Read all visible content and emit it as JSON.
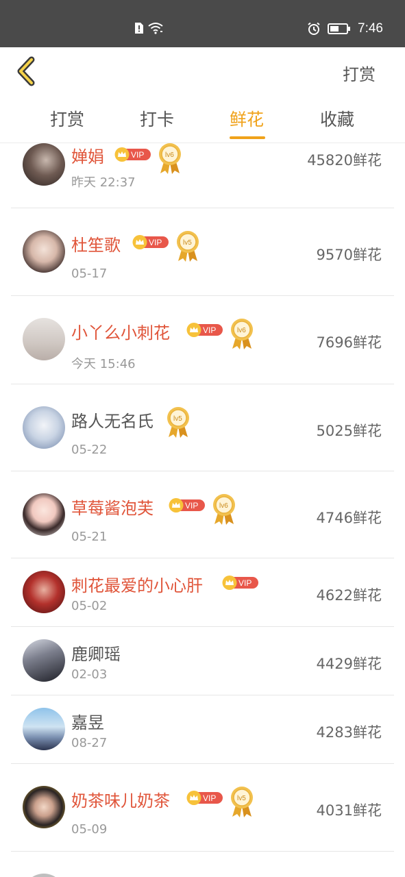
{
  "status_bar": {
    "time": "7:46",
    "icons": [
      "sim-alert-icon",
      "wifi-icon",
      "alarm-icon",
      "battery-icon"
    ]
  },
  "app_bar": {
    "back_icon": "chevron-left-icon",
    "action_label": "打赏"
  },
  "tabs": [
    {
      "label": "打赏",
      "active": false
    },
    {
      "label": "打卡",
      "active": false
    },
    {
      "label": "鲜花",
      "active": true
    },
    {
      "label": "收藏",
      "active": false
    }
  ],
  "vip_label": "VIP",
  "list": [
    {
      "name": "婵娟",
      "date": "昨天 22:37",
      "count": "45820鲜花",
      "vip": true,
      "level": "lv6"
    },
    {
      "name": "杜笙歌",
      "date": "05-17",
      "count": "9570鲜花",
      "vip": true,
      "level": "lv5"
    },
    {
      "name": "小丫么小刺花",
      "date": "今天 15:46",
      "count": "7696鲜花",
      "vip": true,
      "level": "lv6"
    },
    {
      "name": "路人无名氏",
      "date": "05-22",
      "count": "5025鲜花",
      "vip": false,
      "level": "lv5"
    },
    {
      "name": "草莓酱泡芙",
      "date": "05-21",
      "count": "4746鲜花",
      "vip": true,
      "level": "lv6"
    },
    {
      "name": "刺花最爱的小心肝",
      "date": "05-02",
      "count": "4622鲜花",
      "vip": true,
      "level": ""
    },
    {
      "name": "鹿卿瑶",
      "date": "02-03",
      "count": "4429鲜花",
      "vip": false,
      "level": ""
    },
    {
      "name": "嘉昱",
      "date": "08-27",
      "count": "4283鲜花",
      "vip": false,
      "level": ""
    },
    {
      "name": "奶茶味儿奶茶",
      "date": "05-09",
      "count": "4031鲜花",
      "vip": true,
      "level": "lv5"
    }
  ],
  "colors": {
    "accent": "#f0a21a",
    "vip_name": "#e0553a",
    "status_bar": "#4a4a4a"
  }
}
